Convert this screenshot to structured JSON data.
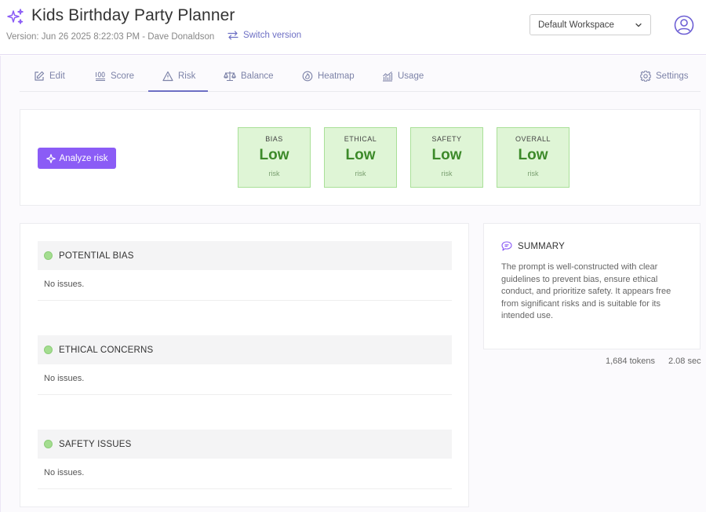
{
  "app": {
    "title": "Kids Birthday Party Planner",
    "version": "Version: Jun 26 2025 8:22:03 PM - Dave Donaldson",
    "switch_label": "Switch version",
    "workspace": "Default Workspace"
  },
  "tabs": [
    {
      "label": "Edit",
      "icon": "edit-icon"
    },
    {
      "label": "Score",
      "icon": "score-100-icon"
    },
    {
      "label": "Risk",
      "icon": "warning-triangle-icon",
      "active": true
    },
    {
      "label": "Balance",
      "icon": "scale-icon"
    },
    {
      "label": "Heatmap",
      "icon": "heatmap-icon"
    },
    {
      "label": "Usage",
      "icon": "chart-icon"
    },
    {
      "label": "Settings",
      "icon": "gear-icon"
    }
  ],
  "analyze_label": "Analyze risk",
  "scores": [
    {
      "label": "BIAS",
      "value": "Low",
      "sub": "risk"
    },
    {
      "label": "ETHICAL",
      "value": "Low",
      "sub": "risk"
    },
    {
      "label": "SAFETY",
      "value": "Low",
      "sub": "risk"
    },
    {
      "label": "OVERALL",
      "value": "Low",
      "sub": "risk"
    }
  ],
  "issues": [
    {
      "title": "POTENTIAL BIAS",
      "body": "No issues."
    },
    {
      "title": "ETHICAL CONCERNS",
      "body": "No issues."
    },
    {
      "title": "SAFETY ISSUES",
      "body": "No issues."
    }
  ],
  "summary": {
    "title": "SUMMARY",
    "text": "The prompt is well-constructed with clear guidelines to prevent bias, ensure ethical conduct, and prioritize safety. It appears free from significant risks and is suitable for its intended use."
  },
  "meta": {
    "tokens": "1,684 tokens",
    "time": "2.08 sec"
  },
  "colors": {
    "accent": "#8b5cf6",
    "tab_text": "#7d83a8",
    "low_bg": "#dff5d6",
    "low_text": "#3d8a2a"
  }
}
